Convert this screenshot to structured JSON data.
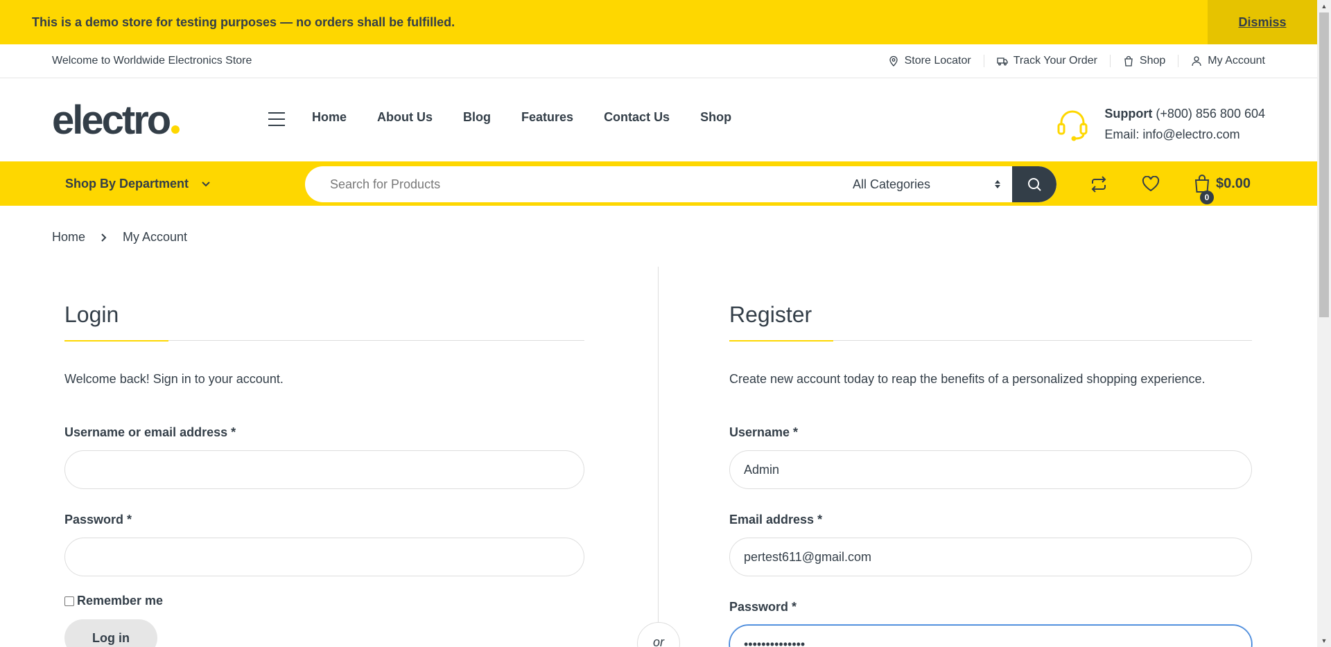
{
  "banner": {
    "message": "This is a demo store for testing purposes — no orders shall be fulfilled.",
    "dismiss_label": "Dismiss"
  },
  "topbar": {
    "welcome": "Welcome to Worldwide Electronics Store",
    "links": [
      {
        "label": "Store Locator",
        "icon": "map-pin-icon"
      },
      {
        "label": "Track Your Order",
        "icon": "truck-icon"
      },
      {
        "label": "Shop",
        "icon": "shopping-bag-icon"
      },
      {
        "label": "My Account",
        "icon": "user-icon"
      }
    ]
  },
  "header": {
    "logo_text": "electro",
    "nav": [
      "Home",
      "About Us",
      "Blog",
      "Features",
      "Contact Us",
      "Shop"
    ],
    "support_label": "Support",
    "support_phone": "(+800) 856 800 604",
    "support_email": "Email: info@electro.com"
  },
  "searchbar": {
    "department_label": "Shop By Department",
    "search_placeholder": "Search for Products",
    "category_selected": "All Categories",
    "cart_count": "0",
    "cart_total": "$0.00"
  },
  "breadcrumb": {
    "home": "Home",
    "current": "My Account"
  },
  "login": {
    "title": "Login",
    "intro": "Welcome back! Sign in to your account.",
    "username_label": "Username or email address *",
    "username_value": "",
    "password_label": "Password *",
    "password_value": "",
    "remember_label": "Remember me",
    "submit_label": "Log in"
  },
  "register": {
    "title": "Register",
    "intro": "Create new account today to reap the benefits of a personalized shopping experience.",
    "username_label": "Username *",
    "username_value": "Admin",
    "email_label": "Email address *",
    "email_value": "pertest611@gmail.com",
    "password_label": "Password *",
    "password_value": "••••••••••••••"
  },
  "or_label": "or",
  "colors": {
    "accent": "#fed700",
    "text": "#333e48",
    "focus": "#2a72cc"
  }
}
